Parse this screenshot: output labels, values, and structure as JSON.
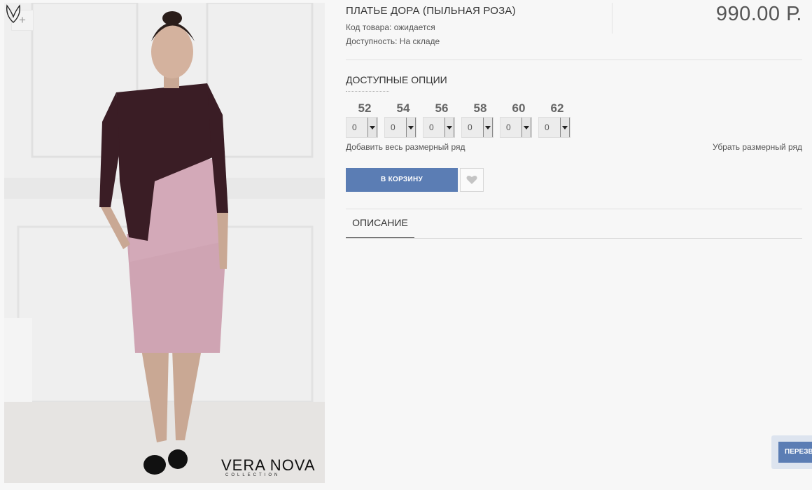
{
  "product": {
    "title": "ПЛАТЬЕ ДОРА (ПЫЛЬНАЯ РОЗА)",
    "sku": "Код товара: ожидается",
    "availability": "Доступность: На складе",
    "price": "990.00 Р."
  },
  "gallery": {
    "zoom_label": "+",
    "brand": "VERA NOVA",
    "brand_sub": "COLLECTION"
  },
  "options": {
    "heading": "ДОСТУПНЫЕ ОПЦИИ",
    "sizes": [
      {
        "size": "52",
        "qty": "0"
      },
      {
        "size": "54",
        "qty": "0"
      },
      {
        "size": "56",
        "qty": "0"
      },
      {
        "size": "58",
        "qty": "0"
      },
      {
        "size": "60",
        "qty": "0"
      },
      {
        "size": "62",
        "qty": "0"
      }
    ],
    "add_all": "Добавить весь размерный ряд",
    "remove_all": "Убрать размерный ряд"
  },
  "actions": {
    "cart_label": "В КОРЗИНУ",
    "wishlist_icon": "heart-icon"
  },
  "tabs": {
    "description": "ОПИСАНИЕ"
  },
  "callback": {
    "label": "ПЕРЕЗВОНИТЬ"
  },
  "colors": {
    "accent": "#5b7db4",
    "dress_pink": "#cfa4b3",
    "lace_dark": "#3a1d25"
  }
}
